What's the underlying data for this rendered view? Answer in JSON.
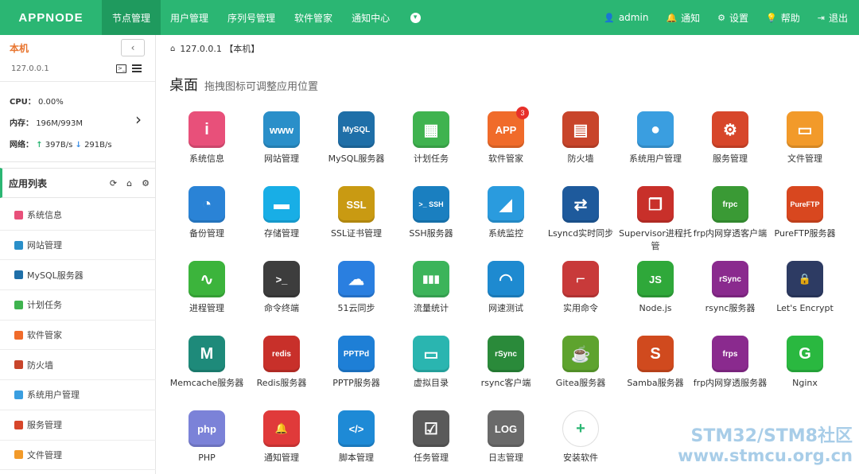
{
  "brand": "APPNODE",
  "nav": [
    "节点管理",
    "用户管理",
    "序列号管理",
    "软件管家",
    "通知中心"
  ],
  "user_menu": [
    {
      "icon": "user-icon",
      "label": "admin"
    },
    {
      "icon": "bell-icon",
      "label": "通知"
    },
    {
      "icon": "gear-icon",
      "label": "设置"
    },
    {
      "icon": "help-icon",
      "label": "帮助"
    },
    {
      "icon": "logout-icon",
      "label": "退出"
    }
  ],
  "host": {
    "name": "本机",
    "ip": "127.0.0.1",
    "cpu_label": "CPU：",
    "cpu": "0.00%",
    "mem_label": "内存：",
    "mem": "196M/993M",
    "net_label": "网络：",
    "up": "397B/s",
    "down": "291B/s"
  },
  "app_list_title": "应用列表",
  "app_list": [
    {
      "label": "系统信息",
      "color": "#e8507a"
    },
    {
      "label": "网站管理",
      "color": "#2a8fc9"
    },
    {
      "label": "MySQL服务器",
      "color": "#1f6fa8"
    },
    {
      "label": "计划任务",
      "color": "#3fb34f"
    },
    {
      "label": "软件管家",
      "color": "#f06b2a"
    },
    {
      "label": "防火墙",
      "color": "#c8452b"
    },
    {
      "label": "系统用户管理",
      "color": "#3a9ee0"
    },
    {
      "label": "服务管理",
      "color": "#d7462a"
    },
    {
      "label": "文件管理",
      "color": "#f29a2a"
    }
  ],
  "breadcrumb": "127.0.0.1 【本机】",
  "desk_title": "桌面",
  "desk_subtitle": "拖拽图标可调整应用位置",
  "apps": [
    {
      "label": "系统信息",
      "glyph": "i",
      "color": "#e8507a"
    },
    {
      "label": "网站管理",
      "glyph": "www",
      "color": "#2a8fc9"
    },
    {
      "label": "MySQL服务器",
      "glyph": "MySQL",
      "color": "#1f6fa8"
    },
    {
      "label": "计划任务",
      "glyph": "▦",
      "color": "#3fb34f"
    },
    {
      "label": "软件管家",
      "glyph": "APP",
      "color": "#f06b2a",
      "badge": "3"
    },
    {
      "label": "防火墙",
      "glyph": "▤",
      "color": "#c8452b"
    },
    {
      "label": "系统用户管理",
      "glyph": "●",
      "color": "#3a9ee0"
    },
    {
      "label": "服务管理",
      "glyph": "⚙",
      "color": "#d7462a"
    },
    {
      "label": "文件管理",
      "glyph": "▭",
      "color": "#f29a2a"
    },
    {
      "label": "备份管理",
      "glyph": "◔",
      "color": "#2a83d6"
    },
    {
      "label": "存储管理",
      "glyph": "▬",
      "color": "#18aee6"
    },
    {
      "label": "SSL证书管理",
      "glyph": "SSL",
      "color": "#c99a12"
    },
    {
      "label": "SSH服务器",
      "glyph": ">_ SSH",
      "color": "#1a7fc0"
    },
    {
      "label": "系统监控",
      "glyph": "◢",
      "color": "#2a9bde"
    },
    {
      "label": "Lsyncd实时同步",
      "glyph": "⇄",
      "color": "#1e5a9c"
    },
    {
      "label": "Supervisor进程托管",
      "glyph": "❐",
      "color": "#c8302a"
    },
    {
      "label": "frp内网穿透客户端",
      "glyph": "frpc",
      "color": "#3a9a35"
    },
    {
      "label": "PureFTP服务器",
      "glyph": "PureFTP",
      "color": "#d8471f"
    },
    {
      "label": "进程管理",
      "glyph": "∿",
      "color": "#3cb43c"
    },
    {
      "label": "命令终端",
      "glyph": ">_",
      "color": "#3d3d3d"
    },
    {
      "label": "51云同步",
      "glyph": "☁",
      "color": "#2a7fe0"
    },
    {
      "label": "流量统计",
      "glyph": "▮▮▮",
      "color": "#3cb45a"
    },
    {
      "label": "网速测试",
      "glyph": "◠",
      "color": "#1e8ad0"
    },
    {
      "label": "实用命令",
      "glyph": "⌐",
      "color": "#c83a3a"
    },
    {
      "label": "Node.js",
      "glyph": "JS",
      "color": "#2fa83a"
    },
    {
      "label": "rsync服务器",
      "glyph": "rSync",
      "color": "#8a2a8e"
    },
    {
      "label": "Let's Encrypt",
      "glyph": "🔒",
      "color": "#2d3b63"
    },
    {
      "label": "Memcache服务器",
      "glyph": "M",
      "color": "#1e8a7a"
    },
    {
      "label": "Redis服务器",
      "glyph": "redis",
      "color": "#c8302a"
    },
    {
      "label": "PPTP服务器",
      "glyph": "PPTPd",
      "color": "#1e7fd6"
    },
    {
      "label": "虚拟目录",
      "glyph": "▭",
      "color": "#2ab5b0"
    },
    {
      "label": "rsync客户端",
      "glyph": "rSync",
      "color": "#2a8a3a"
    },
    {
      "label": "Gitea服务器",
      "glyph": "☕",
      "color": "#5ea32e"
    },
    {
      "label": "Samba服务器",
      "glyph": "S",
      "color": "#d04a1e"
    },
    {
      "label": "frp内网穿透服务器",
      "glyph": "frps",
      "color": "#8a2a8e"
    },
    {
      "label": "Nginx",
      "glyph": "G",
      "color": "#2ab840"
    },
    {
      "label": "PHP",
      "glyph": "php",
      "color": "#7b82d8"
    },
    {
      "label": "通知管理",
      "glyph": "🔔",
      "color": "#e03a3a"
    },
    {
      "label": "脚本管理",
      "glyph": "</>",
      "color": "#1e8ad6"
    },
    {
      "label": "任务管理",
      "glyph": "☑",
      "color": "#5a5a5a"
    },
    {
      "label": "日志管理",
      "glyph": "LOG",
      "color": "#6a6a6a"
    },
    {
      "label": "安装软件",
      "glyph": "+",
      "color": "#ffffff",
      "plus": true
    }
  ],
  "watermark": [
    "STM32/STM8社区",
    "www.stmcu.org.cn"
  ]
}
